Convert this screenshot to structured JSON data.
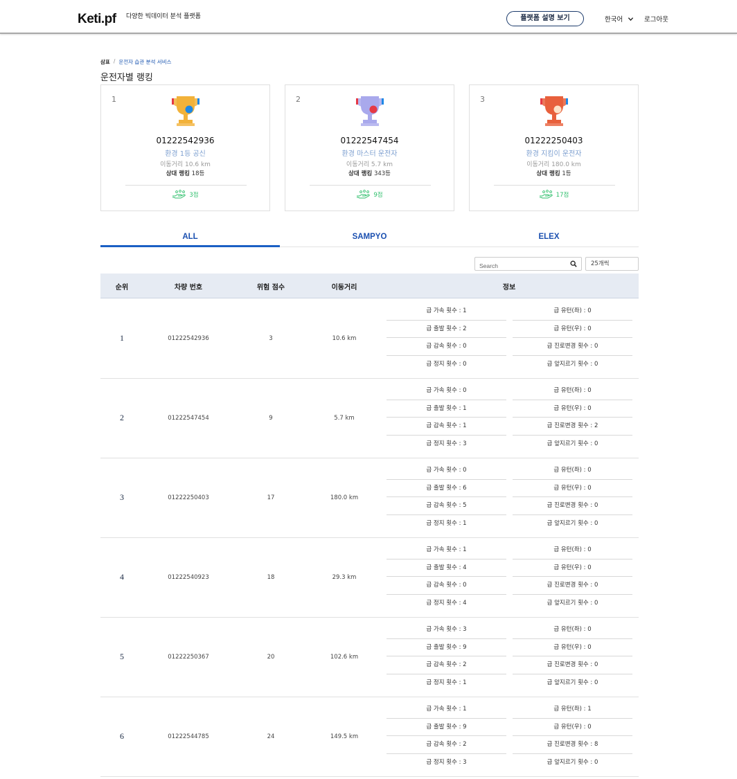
{
  "header": {
    "logo": "Keti.pf",
    "tagline": "다양한 빅데이터 분석 플랫폼",
    "guide_button": "플랫폼 설명 보기",
    "language": "한국어",
    "logout": "로그아웃"
  },
  "breadcrumb": {
    "home": "삼표",
    "sep": "/",
    "current": "운전자 습관 분석 서비스"
  },
  "page_title": "운전자별 랭킹",
  "cards": [
    {
      "rank": "1",
      "plate": "01222542936",
      "title": "환경 1등 공신",
      "distance": "이동거리 10.6 km",
      "rel_label": "상대 랭킹",
      "rel_value": "18등",
      "score": "3점",
      "trophy_color": "#f2b23a",
      "medal_color": "#1e88e5"
    },
    {
      "rank": "2",
      "plate": "01222547454",
      "title": "환경 마스터 운전자",
      "distance": "이동거리 5.7 km",
      "rel_label": "상대 랭킹",
      "rel_value": "343등",
      "score": "9점",
      "trophy_color": "#a9a9ec",
      "medal_color": "#e53945"
    },
    {
      "rank": "3",
      "plate": "01222250403",
      "title": "환경 지킴이 운전자",
      "distance": "이동거리 180.0 km",
      "rel_label": "상대 랭킹",
      "rel_value": "1등",
      "score": "17점",
      "trophy_color": "#e8603c",
      "medal_color": "#fde2c8"
    }
  ],
  "tabs": [
    "ALL",
    "SAMPYO",
    "ELEX"
  ],
  "active_tab": "ALL",
  "search": {
    "placeholder": "Search"
  },
  "per_page": "25개씩",
  "table": {
    "headers": {
      "rank": "순위",
      "plate": "차량 번호",
      "risk": "위험 점수",
      "distance": "이동거리",
      "info": "정보"
    },
    "rows": [
      {
        "rank": "1",
        "plate": "01222542936",
        "risk": "3",
        "distance": "10.6 km",
        "left": [
          "급 가속 횟수 : 1",
          "급 출발 횟수 : 2",
          "급 감속 횟수 : 0",
          "급 정지 횟수 : 0"
        ],
        "right": [
          "급 유턴(좌) : 0",
          "급 유턴(우) : 0",
          "급 진로변경 횟수 : 0",
          "급 앞지르기 횟수 : 0"
        ]
      },
      {
        "rank": "2",
        "plate": "01222547454",
        "risk": "9",
        "distance": "5.7 km",
        "left": [
          "급 가속 횟수 : 0",
          "급 출발 횟수 : 1",
          "급 감속 횟수 : 1",
          "급 정지 횟수 : 3"
        ],
        "right": [
          "급 유턴(좌) : 0",
          "급 유턴(우) : 0",
          "급 진로변경 횟수 : 2",
          "급 앞지르기 횟수 : 0"
        ]
      },
      {
        "rank": "3",
        "plate": "01222250403",
        "risk": "17",
        "distance": "180.0 km",
        "left": [
          "급 가속 횟수 : 0",
          "급 출발 횟수 : 6",
          "급 감속 횟수 : 5",
          "급 정지 횟수 : 1"
        ],
        "right": [
          "급 유턴(좌) : 0",
          "급 유턴(우) : 0",
          "급 진로변경 횟수 : 0",
          "급 앞지르기 횟수 : 0"
        ]
      },
      {
        "rank": "4",
        "plate": "01222540923",
        "risk": "18",
        "distance": "29.3 km",
        "left": [
          "급 가속 횟수 : 1",
          "급 출발 횟수 : 4",
          "급 감속 횟수 : 0",
          "급 정지 횟수 : 4"
        ],
        "right": [
          "급 유턴(좌) : 0",
          "급 유턴(우) : 0",
          "급 진로변경 횟수 : 0",
          "급 앞지르기 횟수 : 0"
        ]
      },
      {
        "rank": "5",
        "plate": "01222250367",
        "risk": "20",
        "distance": "102.6 km",
        "left": [
          "급 가속 횟수 : 3",
          "급 출발 횟수 : 9",
          "급 감속 횟수 : 2",
          "급 정지 횟수 : 1"
        ],
        "right": [
          "급 유턴(좌) : 0",
          "급 유턴(우) : 0",
          "급 진로변경 횟수 : 0",
          "급 앞지르기 횟수 : 0"
        ]
      },
      {
        "rank": "6",
        "plate": "01222544785",
        "risk": "24",
        "distance": "149.5 km",
        "left": [
          "급 가속 횟수 : 1",
          "급 출발 횟수 : 9",
          "급 감속 횟수 : 2",
          "급 정지 횟수 : 3"
        ],
        "right": [
          "급 유턴(좌) : 1",
          "급 유턴(우) : 0",
          "급 진로변경 횟수 : 8",
          "급 앞지르기 횟수 : 0"
        ]
      }
    ]
  }
}
